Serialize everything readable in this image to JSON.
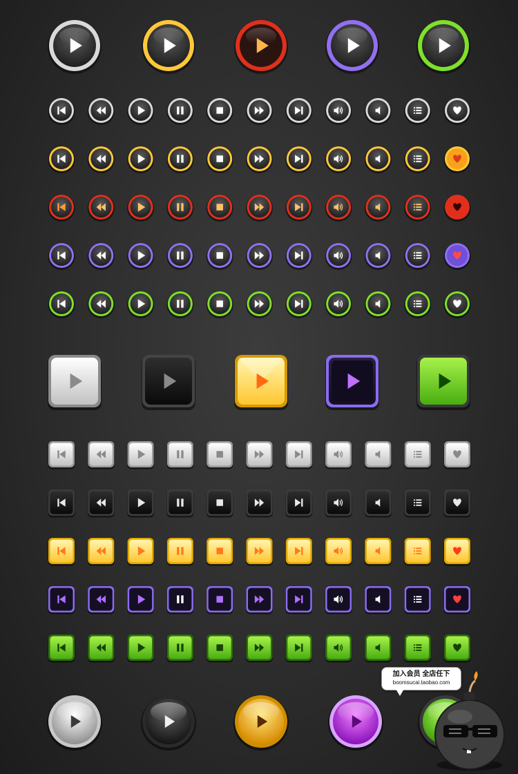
{
  "themes": [
    {
      "name": "white",
      "ring": "#d9d9d9",
      "ringDark": "#8a8a8a",
      "iconCircle": "#ffffff",
      "sq1": "#f4f4f4",
      "sq2": "#bdbdbd",
      "sqIcon": "#9a9a9a",
      "glossy": "#d0d0d0"
    },
    {
      "name": "orange",
      "ring": "#ffc83a",
      "ringDark": "#c87a00",
      "iconCircle": "#ffffff",
      "sq1": "#fff2a6",
      "sq2": "#ffc22c",
      "sqIcon": "#ff7a1a",
      "glossy": "#f4b400"
    },
    {
      "name": "red",
      "ring": "#e0301c",
      "ringDark": "#7a1208",
      "iconCircle": "#ffc36a",
      "sq1": "#2a2a2a",
      "sq2": "#0e0e0e",
      "sqIcon": "#c9c9c9",
      "glossy": "#444444"
    },
    {
      "name": "purple",
      "ring": "#9070f0",
      "ringDark": "#4a2c9a",
      "iconCircle": "#ffffff",
      "sq1": "#9a74ff",
      "sq2": "#4d2ca8",
      "sqIcon": "#ffffff",
      "glossy": "#b030e0"
    },
    {
      "name": "green",
      "ring": "#7ee02a",
      "ringDark": "#3a8a0a",
      "iconCircle": "#ffffff",
      "sq1": "#a0f040",
      "sq2": "#4aac10",
      "sqIcon": "#1d3c06",
      "glossy": "#5ed01a"
    }
  ],
  "icon_row": [
    "skip-back",
    "rewind",
    "play",
    "pause",
    "stop",
    "fast-forward",
    "skip-forward",
    "volume",
    "speaker",
    "list",
    "heart"
  ],
  "promo": {
    "line1": "加入会员 全店任下",
    "line2": "boomsucai.taobao.com"
  }
}
